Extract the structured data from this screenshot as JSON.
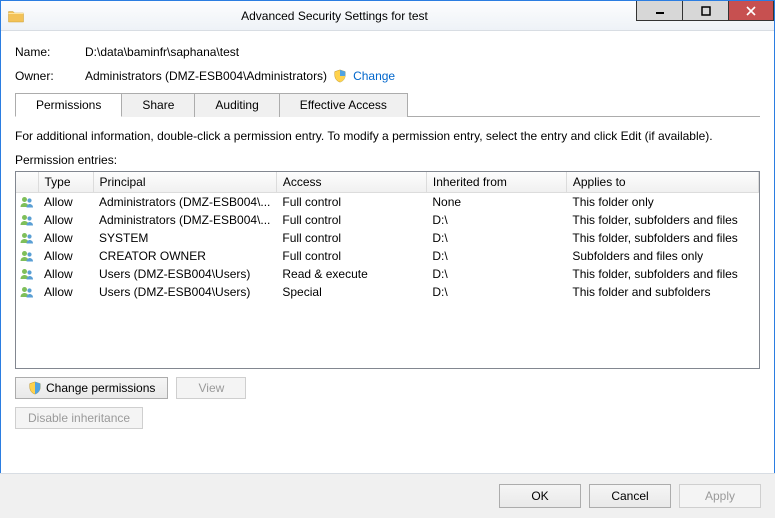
{
  "window": {
    "title": "Advanced Security Settings for test"
  },
  "fields": {
    "name_label": "Name:",
    "name_value": "D:\\data\\baminfr\\saphana\\test",
    "owner_label": "Owner:",
    "owner_value": "Administrators (DMZ-ESB004\\Administrators)",
    "change_link": "Change"
  },
  "tabs": {
    "permissions": "Permissions",
    "share": "Share",
    "auditing": "Auditing",
    "effective": "Effective Access"
  },
  "info_text": "For additional information, double-click a permission entry. To modify a permission entry, select the entry and click Edit (if available).",
  "perm_label": "Permission entries:",
  "columns": {
    "type": "Type",
    "principal": "Principal",
    "access": "Access",
    "inherited": "Inherited from",
    "applies": "Applies to"
  },
  "entries": [
    {
      "type": "Allow",
      "principal": "Administrators (DMZ-ESB004\\...",
      "access": "Full control",
      "inherited": "None",
      "applies": "This folder only"
    },
    {
      "type": "Allow",
      "principal": "Administrators (DMZ-ESB004\\...",
      "access": "Full control",
      "inherited": "D:\\",
      "applies": "This folder, subfolders and files"
    },
    {
      "type": "Allow",
      "principal": "SYSTEM",
      "access": "Full control",
      "inherited": "D:\\",
      "applies": "This folder, subfolders and files"
    },
    {
      "type": "Allow",
      "principal": "CREATOR OWNER",
      "access": "Full control",
      "inherited": "D:\\",
      "applies": "Subfolders and files only"
    },
    {
      "type": "Allow",
      "principal": "Users (DMZ-ESB004\\Users)",
      "access": "Read & execute",
      "inherited": "D:\\",
      "applies": "This folder, subfolders and files"
    },
    {
      "type": "Allow",
      "principal": "Users (DMZ-ESB004\\Users)",
      "access": "Special",
      "inherited": "D:\\",
      "applies": "This folder and subfolders"
    }
  ],
  "buttons": {
    "change_permissions": "Change permissions",
    "view": "View",
    "disable_inheritance": "Disable inheritance",
    "ok": "OK",
    "cancel": "Cancel",
    "apply": "Apply"
  }
}
